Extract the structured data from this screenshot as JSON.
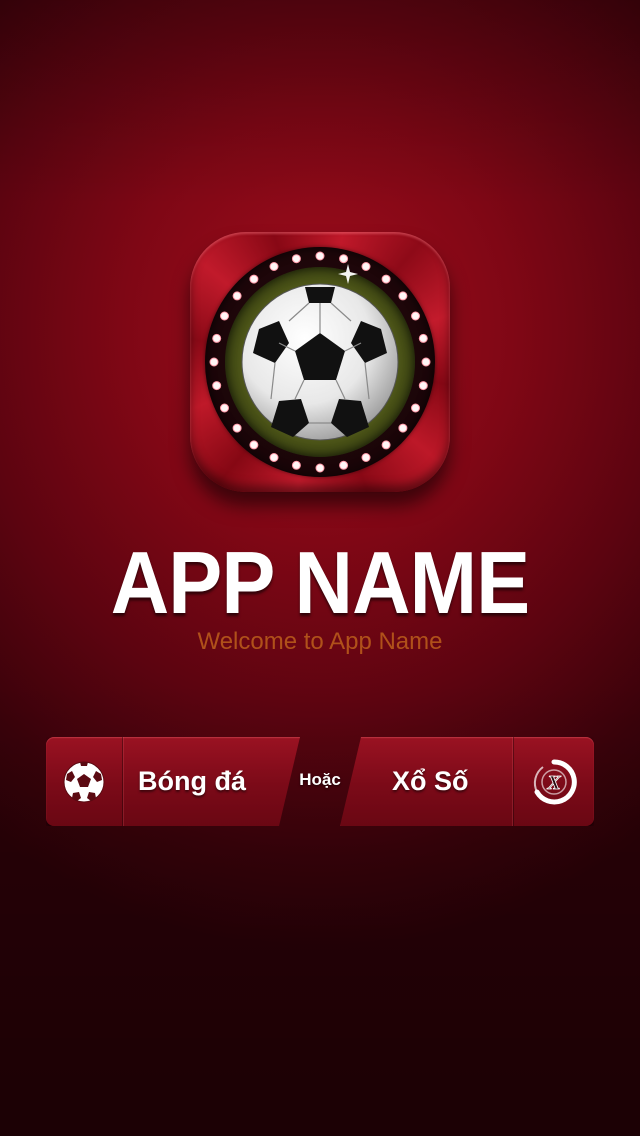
{
  "app": {
    "title": "APP NAME",
    "subtitle": "Welcome to App Name",
    "icon": "soccer-ball-app-icon"
  },
  "choices": {
    "left": {
      "label": "Bóng đá",
      "icon": "soccer-ball-icon"
    },
    "separator": "Hoặc",
    "right": {
      "label": "Xổ Số",
      "icon": "lottery-x-icon"
    }
  },
  "colors": {
    "background": "#7f0715",
    "button": "#8a0e1c",
    "subtitle": "#b0511a",
    "title": "#ffffff"
  }
}
